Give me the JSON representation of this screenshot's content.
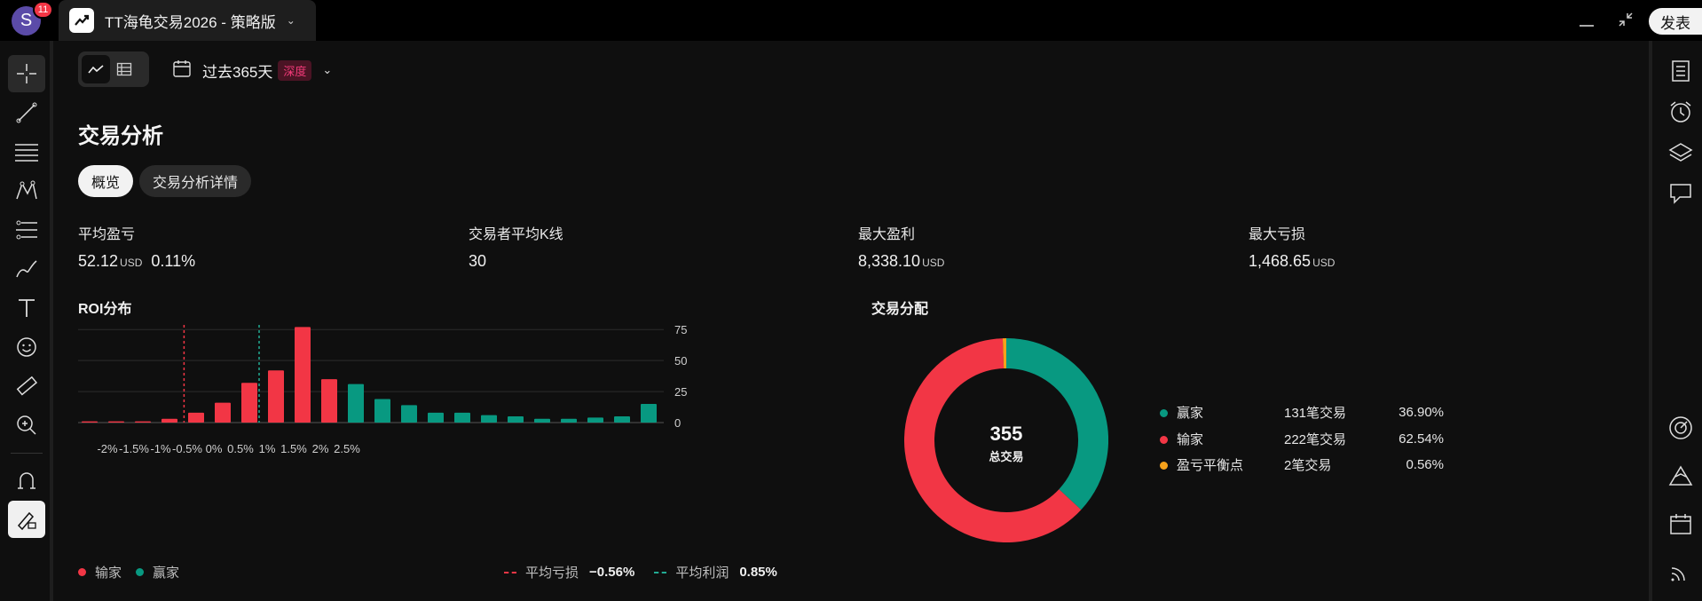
{
  "topbar": {
    "avatar_letter": "S",
    "notif_count": "11",
    "tab_title": "TT海龟交易2026 - 策略版",
    "publish_label": "发表"
  },
  "toolbar": {
    "date_range": "过去365天",
    "deep_tag": "深度"
  },
  "page": {
    "title": "交易分析",
    "tabs": [
      "概览",
      "交易分析详情"
    ]
  },
  "stats": [
    {
      "label": "平均盈亏",
      "value": "52.12",
      "unit": "USD",
      "extra": "0.11%"
    },
    {
      "label": "交易者平均K线",
      "value": "30",
      "unit": "",
      "extra": ""
    },
    {
      "label": "最大盈利",
      "value": "8,338.10",
      "unit": "USD",
      "extra": ""
    },
    {
      "label": "最大亏损",
      "value": "1,468.65",
      "unit": "USD",
      "extra": ""
    }
  ],
  "roi": {
    "title": "ROI分布",
    "legend": {
      "losers": "输家",
      "winners": "赢家",
      "avg_loss_label": "平均亏损",
      "avg_loss_value": "−0.56%",
      "avg_profit_label": "平均利润",
      "avg_profit_value": "0.85%"
    }
  },
  "chart_data": {
    "type": "bar",
    "x_ticks": [
      "-2%",
      "-1.5%",
      "-1%",
      "-0.5%",
      "0%",
      "0.5%",
      "1%",
      "1.5%",
      "2%",
      "2.5%"
    ],
    "y_ticks": [
      "0",
      "25",
      "50",
      "75"
    ],
    "ylim": [
      0,
      78
    ],
    "series": [
      {
        "name": "输家",
        "color": "#f23645",
        "values": [
          1,
          1,
          1,
          3,
          8,
          16,
          32,
          42,
          77,
          35
        ]
      },
      {
        "name": "赢家",
        "color": "#089981",
        "values": [
          31,
          19,
          14,
          8,
          8,
          6,
          5,
          3,
          3,
          4,
          5,
          15
        ]
      }
    ],
    "avg_loss_line": -0.56,
    "avg_profit_line": 0.85
  },
  "distribution": {
    "title": "交易分配",
    "total": "355",
    "total_label": "总交易",
    "rows": [
      {
        "name": "赢家",
        "count": "131笔交易",
        "pct": "36.90%",
        "color": "#089981",
        "share": 36.9
      },
      {
        "name": "输家",
        "count": "222笔交易",
        "pct": "62.54%",
        "color": "#f23645",
        "share": 62.54
      },
      {
        "name": "盈亏平衡点",
        "count": "2笔交易",
        "pct": "0.56%",
        "color": "#f7a21b",
        "share": 0.56
      }
    ]
  }
}
